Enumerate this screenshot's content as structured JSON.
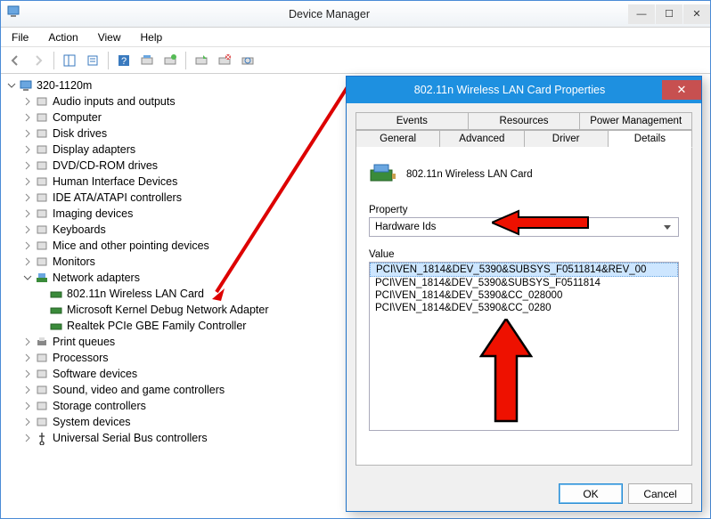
{
  "window": {
    "title": "Device Manager",
    "menu": {
      "file": "File",
      "action": "Action",
      "view": "View",
      "help": "Help"
    }
  },
  "tree": {
    "root": "320-1120m",
    "items": [
      "Audio inputs and outputs",
      "Computer",
      "Disk drives",
      "Display adapters",
      "DVD/CD-ROM drives",
      "Human Interface Devices",
      "IDE ATA/ATAPI controllers",
      "Imaging devices",
      "Keyboards",
      "Mice and other pointing devices",
      "Monitors",
      "Network adapters",
      "Print queues",
      "Processors",
      "Software devices",
      "Sound, video and game controllers",
      "Storage controllers",
      "System devices",
      "Universal Serial Bus controllers"
    ],
    "network_children": [
      "802.11n Wireless LAN Card",
      "Microsoft Kernel Debug Network Adapter",
      "Realtek PCIe GBE Family Controller"
    ]
  },
  "dialog": {
    "title": "802.11n Wireless LAN Card Properties",
    "tabs_row1": [
      "Events",
      "Resources",
      "Power Management"
    ],
    "tabs_row2": [
      "General",
      "Advanced",
      "Driver",
      "Details"
    ],
    "device_name": "802.11n Wireless LAN Card",
    "property_label": "Property",
    "property_value": "Hardware Ids",
    "value_label": "Value",
    "values": [
      "PCI\\VEN_1814&DEV_5390&SUBSYS_F0511814&REV_00",
      "PCI\\VEN_1814&DEV_5390&SUBSYS_F0511814",
      "PCI\\VEN_1814&DEV_5390&CC_028000",
      "PCI\\VEN_1814&DEV_5390&CC_0280"
    ],
    "ok": "OK",
    "cancel": "Cancel"
  }
}
